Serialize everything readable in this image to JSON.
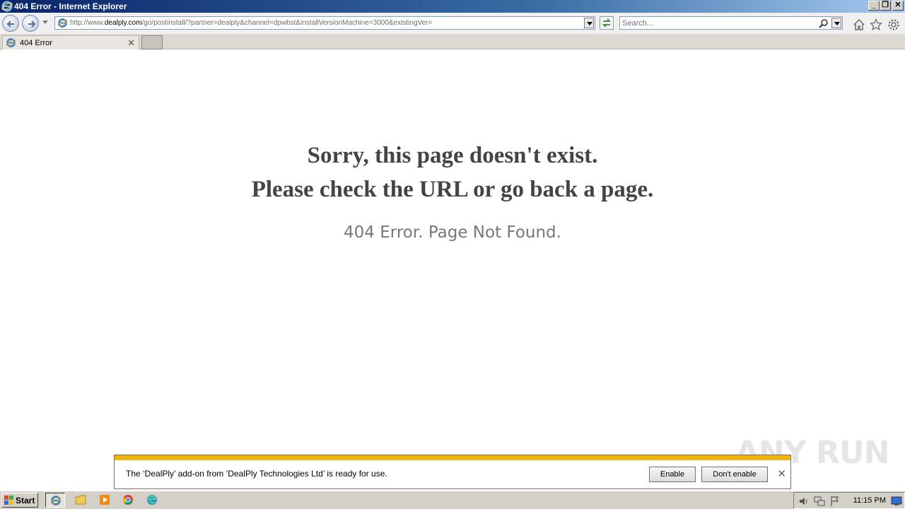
{
  "window": {
    "title": "404 Error - Internet Explorer"
  },
  "address_bar": {
    "url_prefix": "http://www.",
    "url_domain": "dealply.com",
    "url_rest": "/go/postinstall/?partner=dealply&channel=dpwbst&installVersionMachine=3000&existingVer="
  },
  "search": {
    "placeholder": "Search..."
  },
  "tabs": [
    {
      "label": "404 Error"
    }
  ],
  "page": {
    "heading_line1": "Sorry, this page doesn't exist.",
    "heading_line2": "Please check the URL or go back a page.",
    "subtext": "404 Error. Page Not Found."
  },
  "notification": {
    "message": "The ‘DealPly’ add-on from ‘DealPly Technologies Ltd’ is ready for use.",
    "enable_label": "Enable",
    "dont_enable_label": "Don't enable",
    "accent_color": "#f0b40f"
  },
  "watermark": "ANY RUN",
  "taskbar": {
    "start_label": "Start",
    "clock": "11:15 PM"
  }
}
